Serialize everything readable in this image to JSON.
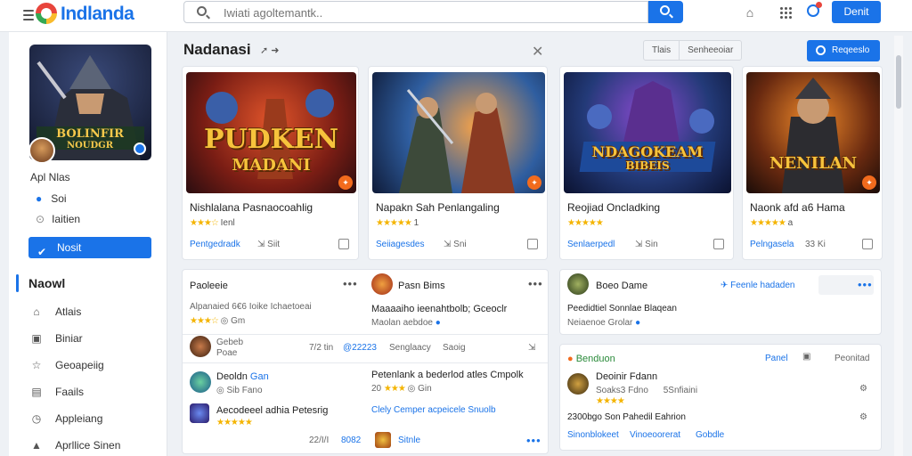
{
  "app": {
    "title": "Indlanda",
    "search_placeholder": "Iwiati agoltemantk..",
    "top_button": "Denit"
  },
  "sidebar": {
    "profile": {
      "name": "Apl Nlas",
      "line2": "Soi",
      "line3": "Iaitien"
    },
    "primary_button": "Nosit",
    "section": "Naowl",
    "items": [
      {
        "label": "Atlais",
        "icon": "home-icon"
      },
      {
        "label": "Biniar",
        "icon": "bookmark-icon"
      },
      {
        "label": "Geoapeiig",
        "icon": "star-icon"
      },
      {
        "label": "Faails",
        "icon": "list-icon"
      },
      {
        "label": "Appleiang",
        "icon": "clock-icon"
      },
      {
        "label": "Aprllice Sinen",
        "icon": "lock-icon"
      }
    ]
  },
  "main": {
    "title": "Nadanasi",
    "tabs": [
      "Tlais",
      "Senheeoiar"
    ],
    "request_button": "Reqeeslo"
  },
  "cards": [
    {
      "art_title": "PUDKEN",
      "art_sub": "MADANI",
      "title": "Nishlalana Pasnaocoahlig",
      "rating_text": "Ienl",
      "meta": "Pentgedradk",
      "meta2": "Siit"
    },
    {
      "art_title": "",
      "art_sub": "",
      "title": "Napakn Sah Penlangaling",
      "rating_text": "1",
      "meta": "Seiiagesdes",
      "meta2": "Sni"
    },
    {
      "art_title": "NDAGOKEAM",
      "art_sub": "BIBEIS",
      "title": "Reojiad Oncladking",
      "rating_text": "",
      "meta": "Senlaerpedl",
      "meta2": "Sin"
    },
    {
      "art_title": "NENILAN",
      "art_sub": "",
      "title": "Naonk afd a6 Hama",
      "rating_text": "a",
      "meta": "Pelngasela",
      "meta2": "33 Ki"
    }
  ],
  "feed_left": {
    "col1": {
      "title": "Paoleeie",
      "subtitle": "Alpanaied 6€6 Ioike Ichaetoeai",
      "rating": "Gm",
      "user_row": {
        "name": "Gebeb",
        "sub": "Poae",
        "time": "7/2 tin",
        "count": "@22223"
      },
      "item2": {
        "name": "Deoldn",
        "tag": "Gan",
        "sub": "Sib Fano"
      },
      "item3": {
        "title": "Aecodeeel adhia Petesrig"
      },
      "footer": {
        "time": "22/I/I",
        "count": "8082"
      }
    },
    "col2": {
      "title": "Pasn Bims",
      "subtitle": "Maaaaiho ieenahtbolb; Gceoclr",
      "sub2": "Maolan aebdoe",
      "row": {
        "left": "Senglaacy",
        "right": "Saoig"
      },
      "item2": {
        "title": "Petenlank a bederlod atles Cmpolk",
        "sub": "20",
        "sub2": "Gin"
      },
      "item3": {
        "title": "Clely Cemper acpeicele Snuolb"
      },
      "footer": {
        "label": "Sitnle"
      }
    }
  },
  "feed_right": {
    "top": {
      "name": "Boeo Dame",
      "link": "Feenle hadaden",
      "line1": "Peedidtiel Sonnlae Blaqean",
      "line2": "Neiaenoe Grolar"
    },
    "bottom": {
      "badge": "Benduon",
      "tabs": [
        "Panel",
        "Peonitad"
      ],
      "name": "Deoinir Fdann",
      "sub1": "Soaks3 Fdno",
      "sub2": "5Snfiaini",
      "line": "2300bgo Son Pahedil Eahrion",
      "links": [
        "Sinonblokeet",
        "Vinoeoorerat",
        "Gobdle"
      ]
    }
  }
}
